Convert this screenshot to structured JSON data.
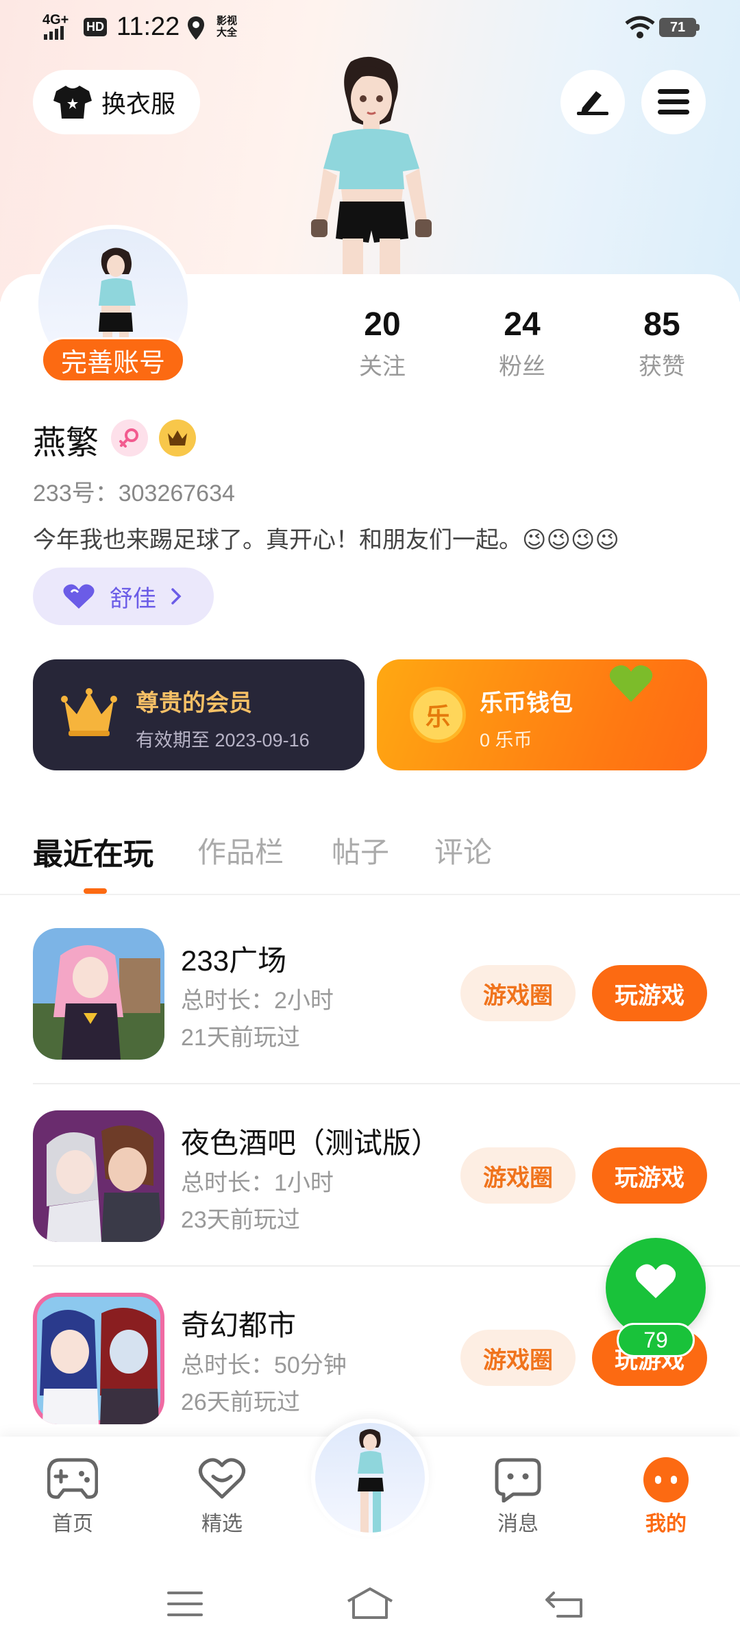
{
  "status_bar": {
    "network": "4G+",
    "hd": "HD",
    "time": "11:22",
    "app_label": "影视大全",
    "battery": "71"
  },
  "header": {
    "dress_button_label": "换衣服"
  },
  "profile": {
    "complete_account_label": "完善账号",
    "stats": [
      {
        "value": "20",
        "label": "关注"
      },
      {
        "value": "24",
        "label": "粉丝"
      },
      {
        "value": "85",
        "label": "获赞"
      }
    ],
    "name": "燕繁",
    "id_line": "233号：303267634",
    "bio": "今年我也来踢足球了。真开心！和朋友们一起。😉😉😉😉",
    "friend_tag": "舒佳"
  },
  "member_card": {
    "title": "尊贵的会员",
    "expiry": "有效期至 2023-09-16"
  },
  "wallet_card": {
    "title": "乐币钱包",
    "balance": "0 乐币",
    "coin_glyph": "乐"
  },
  "tabs": [
    {
      "label": "最近在玩",
      "active": true
    },
    {
      "label": "作品栏",
      "active": false
    },
    {
      "label": "帖子",
      "active": false
    },
    {
      "label": "评论",
      "active": false
    }
  ],
  "games": [
    {
      "title": "233广场",
      "duration": "总时长：2小时",
      "last_played": "21天前玩过",
      "circle_label": "游戏圈",
      "play_label": "玩游戏"
    },
    {
      "title": "夜色酒吧（测试版）",
      "duration": "总时长：1小时",
      "last_played": "23天前玩过",
      "circle_label": "游戏圈",
      "play_label": "玩游戏"
    },
    {
      "title": "奇幻都市",
      "duration": "总时长：50分钟",
      "last_played": "26天前玩过",
      "circle_label": "游戏圈",
      "play_label": "玩游戏"
    }
  ],
  "floating_like": {
    "count": "79"
  },
  "bottom_nav": [
    {
      "label": "首页"
    },
    {
      "label": "精选"
    },
    {
      "label": "消息"
    },
    {
      "label": "我的",
      "active": true
    }
  ],
  "colors": {
    "accent": "#fc6a12",
    "member_bg": "#272638",
    "like_green": "#19c23a",
    "friend_purple": "#6b5ce7"
  }
}
